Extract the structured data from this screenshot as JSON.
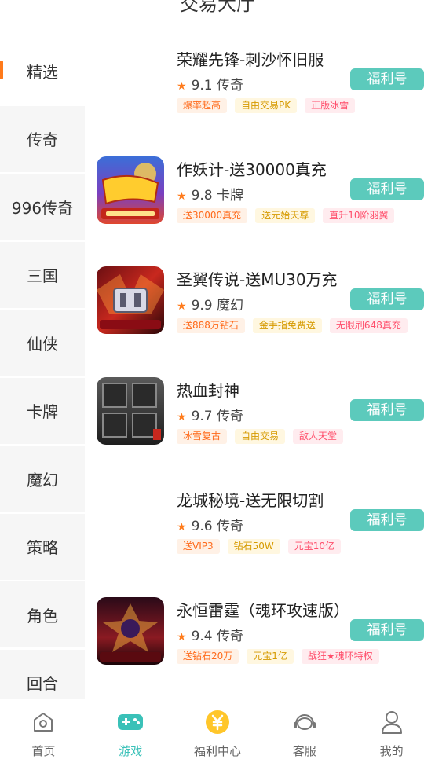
{
  "header": {
    "title": "交易大厅"
  },
  "sidebar": {
    "items": [
      {
        "label": "精选",
        "active": true
      },
      {
        "label": "传奇"
      },
      {
        "label": "996传奇"
      },
      {
        "label": "三国"
      },
      {
        "label": "仙侠"
      },
      {
        "label": "卡牌"
      },
      {
        "label": "魔幻"
      },
      {
        "label": "策略"
      },
      {
        "label": "角色"
      },
      {
        "label": "回合"
      }
    ]
  },
  "games": [
    {
      "name": "荣耀先锋-刺沙怀旧服",
      "score": "9.1",
      "genre": "传奇",
      "badge": "福利号",
      "tags": [
        {
          "text": "爆率超高",
          "color": "orange"
        },
        {
          "text": "自由交易PK",
          "color": "yellow"
        },
        {
          "text": "正版冰雪",
          "color": "pink"
        }
      ],
      "has_icon": false
    },
    {
      "name": "作妖计-送30000真充",
      "score": "9.8",
      "genre": "卡牌",
      "badge": "福利号",
      "tags": [
        {
          "text": "送30000真充",
          "color": "orange"
        },
        {
          "text": "送元始天尊",
          "color": "yellow"
        },
        {
          "text": "直升10阶羽翼",
          "color": "pink"
        }
      ],
      "has_icon": true
    },
    {
      "name": "圣翼传说-送MU30万充",
      "score": "9.9",
      "genre": "魔幻",
      "badge": "福利号",
      "tags": [
        {
          "text": "送888万钻石",
          "color": "orange"
        },
        {
          "text": "金手指免费送",
          "color": "yellow"
        },
        {
          "text": "无限刷648真充",
          "color": "pink"
        }
      ],
      "has_icon": true
    },
    {
      "name": "热血封神",
      "score": "9.7",
      "genre": "传奇",
      "badge": "福利号",
      "tags": [
        {
          "text": "冰雪复古",
          "color": "orange"
        },
        {
          "text": "自由交易",
          "color": "yellow"
        },
        {
          "text": "敌人天堂",
          "color": "pink"
        }
      ],
      "has_icon": true
    },
    {
      "name": "龙城秘境-送无限切割",
      "score": "9.6",
      "genre": "传奇",
      "badge": "福利号",
      "tags": [
        {
          "text": "送VIP3",
          "color": "orange"
        },
        {
          "text": "钻石50W",
          "color": "yellow"
        },
        {
          "text": "元宝10亿",
          "color": "pink"
        }
      ],
      "has_icon": false
    },
    {
      "name": "永恒雷霆（魂环攻速版）",
      "score": "9.4",
      "genre": "传奇",
      "badge": "福利号",
      "tags": [
        {
          "text": "送钻石20万",
          "color": "orange"
        },
        {
          "text": "元宝1亿",
          "color": "yellow"
        },
        {
          "text": "战狂★魂环特权",
          "color": "pink"
        }
      ],
      "has_icon": true
    }
  ],
  "tabbar": {
    "items": [
      {
        "label": "首页",
        "icon": "home-icon"
      },
      {
        "label": "游戏",
        "icon": "gamepad-icon",
        "active": true
      },
      {
        "label": "福利中心",
        "icon": "yen-coin-icon"
      },
      {
        "label": "客服",
        "icon": "headset-icon"
      },
      {
        "label": "我的",
        "icon": "user-icon"
      }
    ]
  },
  "colors": {
    "accent": "#3ac1b8",
    "badge": "#5ccabc",
    "orange": "#ff7a1a"
  }
}
